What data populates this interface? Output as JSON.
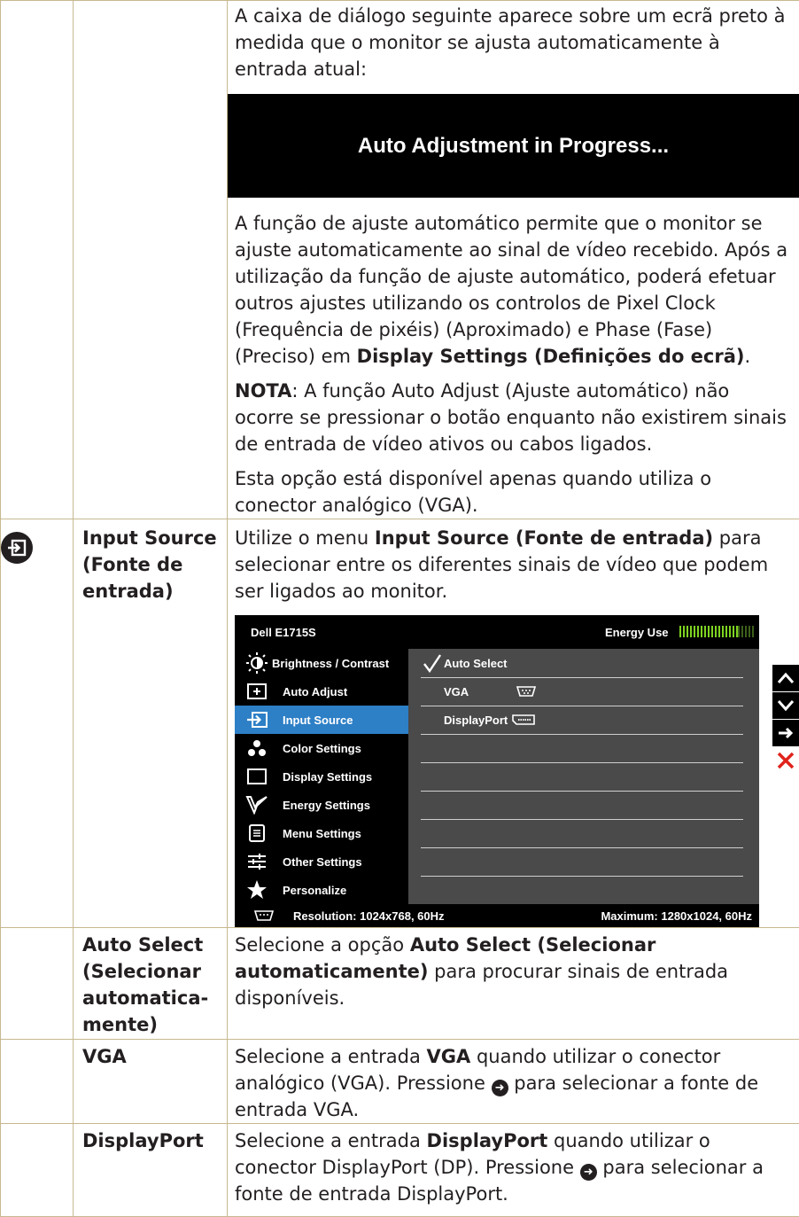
{
  "section1": {
    "intro": "A caixa de diálogo seguinte aparece sobre um ecrã preto à medida que o monitor se ajusta automaticamente à entrada atual:",
    "dialog_text": "Auto Adjustment in Progress...",
    "para1": "A função de ajuste automático permite que o monitor se ajuste automaticamente ao sinal de vídeo recebido. Após a utilização da função de ajuste automático, poderá efetuar outros ajustes utilizando os controlos de Pixel Clock (Frequência de pixéis) (Aproximado) e Phase (Fase) (Preciso) em ",
    "para1_bold": "Display Settings (Definições do ecrã)",
    "para1_end": ".",
    "note_label": "NOTA",
    "note_text": ": A função Auto Adjust (Ajuste automático) não ocorre se pressionar o botão enquanto não existirem sinais de entrada de vídeo ativos ou cabos ligados.",
    "para3": "Esta opção está disponível apenas quando utiliza o conector analógico (VGA)."
  },
  "input_source": {
    "label": "Input Source (Fonte de entrada)",
    "text_a": "Utilize o menu ",
    "text_bold": "Input Source (Fonte de entrada)",
    "text_b": " para selecionar entre os diferentes sinais de vídeo que podem ser ligados ao monitor."
  },
  "osd": {
    "model": "Dell E1715S",
    "energy_label": "Energy Use",
    "menu": [
      {
        "label": "Brightness / Contrast",
        "icon": "brightness-icon"
      },
      {
        "label": "Auto Adjust",
        "icon": "auto-adjust-icon"
      },
      {
        "label": "Input Source",
        "icon": "input-source-icon",
        "selected": true
      },
      {
        "label": "Color Settings",
        "icon": "color-settings-icon"
      },
      {
        "label": "Display Settings",
        "icon": "display-settings-icon"
      },
      {
        "label": "Energy Settings",
        "icon": "energy-settings-icon"
      },
      {
        "label": "Menu Settings",
        "icon": "menu-settings-icon"
      },
      {
        "label": "Other Settings",
        "icon": "other-settings-icon"
      },
      {
        "label": "Personalize",
        "icon": "star-icon"
      }
    ],
    "submenu": [
      "Auto Select",
      "VGA",
      "DisplayPort"
    ],
    "resolution": "Resolution: 1024x768, 60Hz",
    "maximum": "Maximum: 1280x1024, 60Hz"
  },
  "auto_select": {
    "label": "Auto Select (Selecionar automatica-mente)",
    "text_a": "Selecione a opção ",
    "text_bold": "Auto Select (Selecionar automaticamente)",
    "text_b": " para procurar sinais de entrada disponíveis."
  },
  "vga": {
    "label": "VGA",
    "text_a": "Selecione a entrada ",
    "text_bold": "VGA",
    "text_b": " quando utilizar o conector analógico (VGA). Pressione ",
    "text_c": " para selecionar a fonte de entrada VGA."
  },
  "displayport": {
    "label": "DisplayPort",
    "text_a": "Selecione a entrada ",
    "text_bold": "DisplayPort",
    "text_b": " quando utilizar o conector DisplayPort (DP). Pressione ",
    "text_c": " para selecionar a fonte de entrada DisplayPort."
  }
}
